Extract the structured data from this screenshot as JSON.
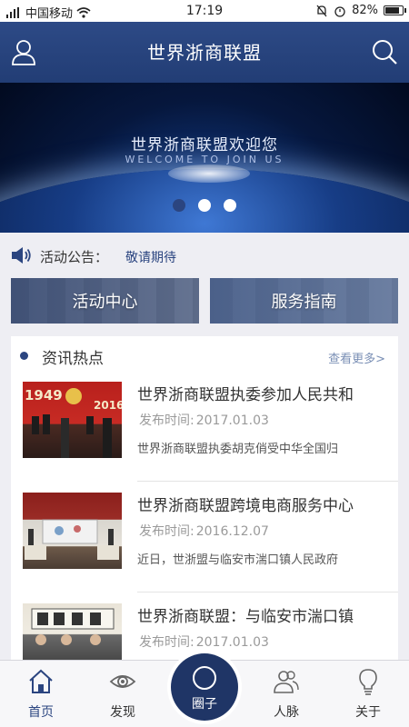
{
  "status_bar": {
    "carrier": "中国移动",
    "time": "17:19",
    "battery": "82%",
    "battery_level": 0.82
  },
  "header": {
    "title": "世界浙商联盟",
    "user_icon": "user-icon",
    "search_icon": "search-icon"
  },
  "banner": {
    "title": "世界浙商联盟欢迎您",
    "subtitle": "WELCOME TO JOIN US",
    "slide_count": 3,
    "active_slide": 0
  },
  "announcement": {
    "icon": "speaker-icon",
    "label": "活动公告：",
    "value": "敬请期待"
  },
  "quick_links": [
    {
      "label": "活动中心"
    },
    {
      "label": "服务指南"
    }
  ],
  "news": {
    "title": "资讯热点",
    "more": "查看更多>",
    "items": [
      {
        "title": "世界浙商联盟执委参加人民共和",
        "date_label": "发布时间:",
        "date": "2017.01.03",
        "summary": "世界浙商联盟执委胡克俏受中华全国归"
      },
      {
        "title": "世界浙商联盟跨境电商服务中心",
        "date_label": "发布时间:",
        "date": "2016.12.07",
        "summary": "近日，世浙盟与临安市湍口镇人民政府"
      },
      {
        "title": "世界浙商联盟：与临安市湍口镇",
        "date_label": "发布时间:",
        "date": "2017.01.03",
        "summary": ""
      }
    ]
  },
  "bottom_nav": {
    "items": [
      {
        "label": "首页",
        "icon": "home-icon"
      },
      {
        "label": "发现",
        "icon": "eye-icon"
      },
      {
        "label": "圈子",
        "icon": "circle-icon"
      },
      {
        "label": "人脉",
        "icon": "contacts-icon"
      },
      {
        "label": "关于",
        "icon": "lightbulb-icon"
      }
    ]
  },
  "colors": {
    "brand": "#2b4580",
    "header_bg": "#2d4a86",
    "fab_bg": "#1f3566"
  }
}
